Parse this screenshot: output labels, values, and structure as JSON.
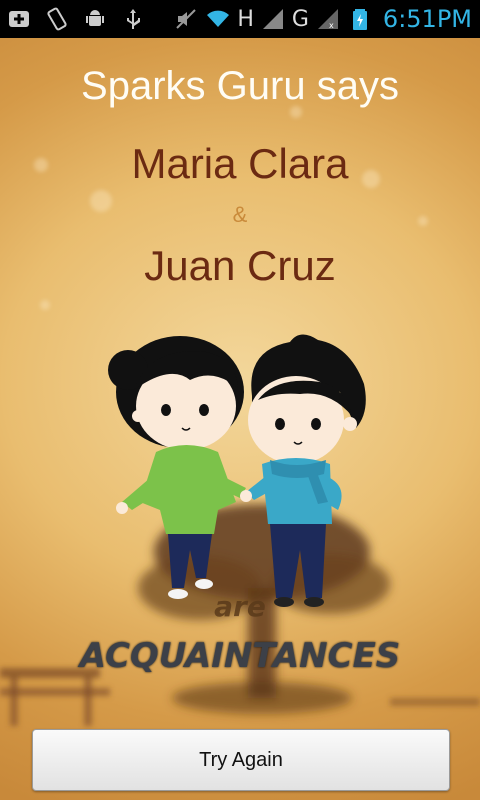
{
  "status_bar": {
    "left_icons": [
      "add-notification-icon",
      "screen-rotate-icon",
      "android-debug-icon",
      "usb-icon"
    ],
    "right_icons": [
      "mute-icon",
      "wifi-icon"
    ],
    "network1_label": "H",
    "network2_label": "G",
    "time": "6:51PM",
    "accent": "#33b5e5"
  },
  "result": {
    "heading": "Sparks Guru says",
    "name1": "Maria Clara",
    "ampersand": "&",
    "name2": "Juan Cruz",
    "connector": "are",
    "relationship": "ACQUAINTANCES"
  },
  "actions": {
    "try_again_label": "Try Again"
  },
  "colors": {
    "name_color": "#6b2a12",
    "background_top": "#f3d79b",
    "background_bottom": "#c8893a"
  }
}
